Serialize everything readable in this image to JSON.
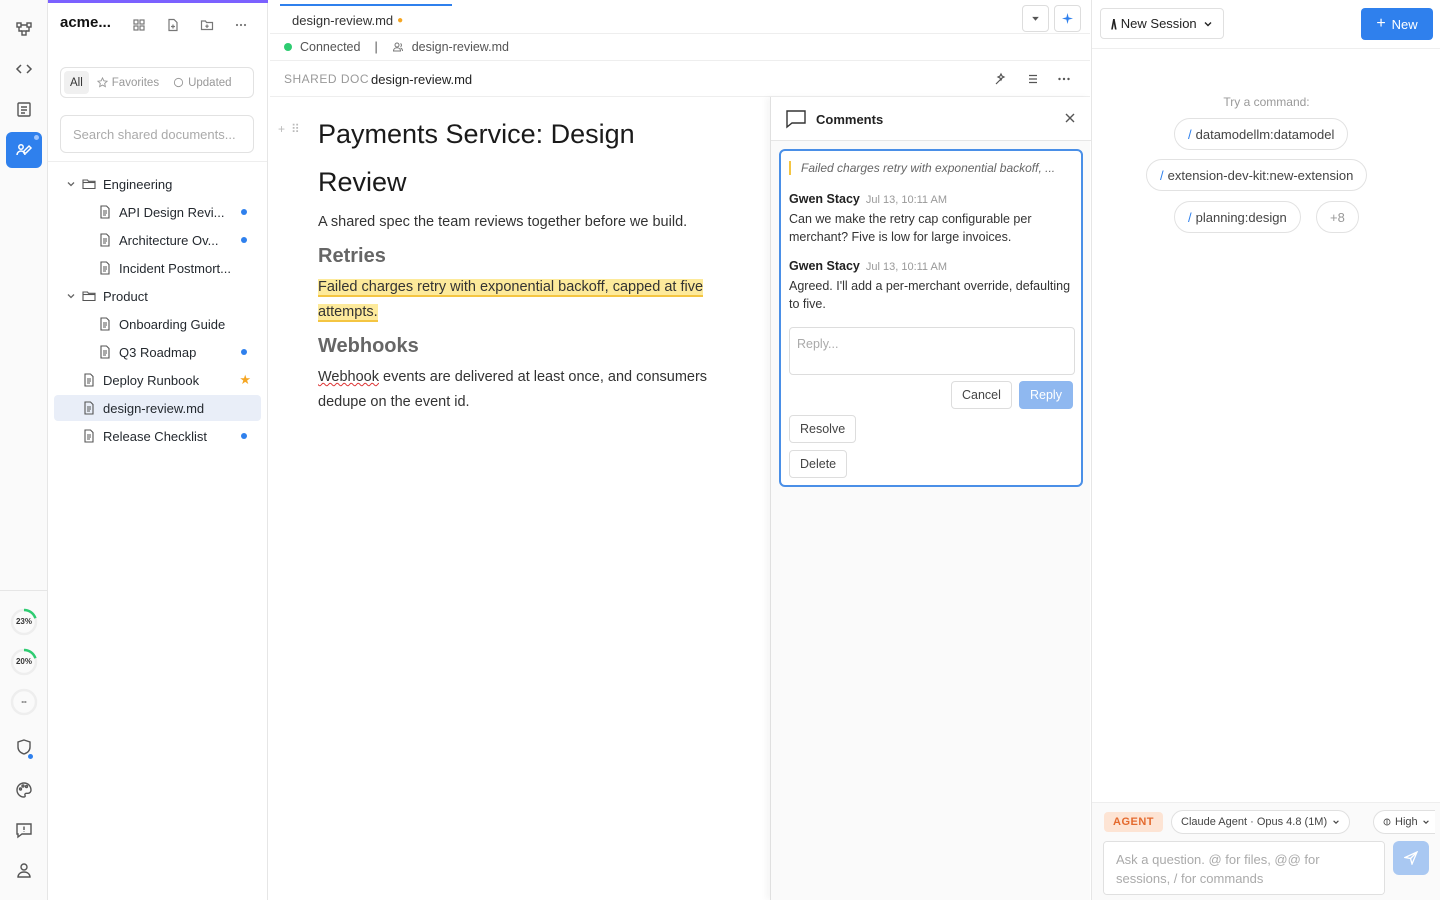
{
  "sidebar": {
    "title": "acme...",
    "filters": [
      {
        "label": "All"
      },
      {
        "label": "Favorites"
      },
      {
        "label": "Updated"
      }
    ],
    "search_placeholder": "Search shared documents...",
    "tree": {
      "engineering": "Engineering",
      "api_design": "API Design Revi...",
      "architecture": "Architecture Ov...",
      "incident": "Incident Postmort...",
      "product": "Product",
      "onboarding": "Onboarding Guide",
      "roadmap": "Q3 Roadmap",
      "deploy": "Deploy Runbook",
      "design_review": "design-review.md",
      "release": "Release Checklist"
    }
  },
  "rail": {
    "gauges": [
      {
        "label": "23%",
        "value": 0.23
      },
      {
        "label": "20%",
        "value": 0.2
      },
      {
        "label": "--"
      }
    ]
  },
  "editor": {
    "tab_label": "design-review.md",
    "tab_modified": "●",
    "status": "Connected",
    "status_sep": "|",
    "status_file": "design-review.md",
    "doc_kicker": "SHARED DOC",
    "doc_name": "design-review.md",
    "title": "Payments Service: Design Review",
    "intro": "A shared spec the team reviews together before we build.",
    "h_retries": "Retries",
    "retries_text": "Failed charges retry with exponential backoff, capped at five attempts.",
    "h_webhooks": "Webhooks",
    "webhooks_word": "Webhook",
    "webhooks_rest": " events are delivered at least once, and consumers dedupe on the event id."
  },
  "comments": {
    "title": "Comments",
    "quote": "Failed charges retry with exponential backoff, ...",
    "messages": [
      {
        "author": "Gwen Stacy",
        "time": "Jul 13, 10:11 AM",
        "body": "Can we make the retry cap configurable per merchant? Five is low for large invoices."
      },
      {
        "author": "Gwen Stacy",
        "time": "Jul 13, 10:11 AM",
        "body": "Agreed. I'll add a per-merchant override, defaulting to five."
      }
    ],
    "reply_placeholder": "Reply...",
    "cancel": "Cancel",
    "reply": "Reply",
    "resolve": "Resolve",
    "delete": "Delete"
  },
  "agent_panel": {
    "session_label": "New Session",
    "new_label": "New",
    "try_label": "Try a command:",
    "commands": [
      {
        "slash": "/",
        "text": "datamodellm:datamodel"
      },
      {
        "slash": "/",
        "text": "extension-dev-kit:new-extension"
      },
      {
        "slash": "/",
        "text": "planning:design"
      }
    ],
    "more": "+8",
    "agent_badge": "AGENT",
    "model": "Claude Agent · Opus 4.8 (1M)",
    "effort": "High",
    "ask_placeholder": "Ask a question. @ for files, @@ for sessions, / for commands"
  },
  "colors": {
    "accent": "#2f80ed",
    "highlight": "#fdea9b",
    "connected": "#2ecc71",
    "favorite": "#f5a623",
    "agent_badge": "#e46a2e"
  }
}
